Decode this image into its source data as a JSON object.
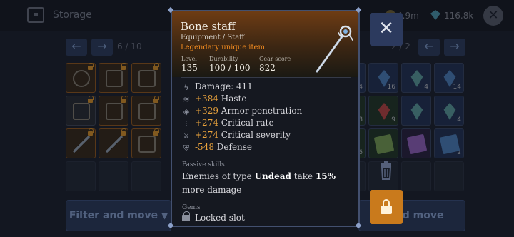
{
  "storage": {
    "title": "Storage",
    "gold": "4.9m",
    "gems": "116.8k",
    "close_label": "✕"
  },
  "left_pager": {
    "page": "6 / 10",
    "prev": "←",
    "next": "→"
  },
  "right_pager": {
    "page": "2 / 2",
    "prev": "←",
    "next": "→"
  },
  "left_grid": {
    "rows": [
      [
        {
          "icon": "ring-icon",
          "rarity": "orange"
        },
        {
          "icon": "gloves-icon",
          "rarity": "orange"
        },
        {
          "icon": "chest-armor-icon",
          "rarity": "orange"
        }
      ],
      [
        {
          "icon": "pauldron-icon",
          "rarity": "grey"
        },
        {
          "icon": "gloves-icon",
          "rarity": "orange"
        },
        {
          "icon": "chest-armor-icon",
          "rarity": "orange"
        }
      ],
      [
        {
          "icon": "staff-icon",
          "rarity": "orange"
        },
        {
          "icon": "staff-icon",
          "rarity": "orange"
        },
        {
          "icon": "crown-icon",
          "rarity": "orange"
        }
      ]
    ]
  },
  "right_grid": {
    "rows": [
      [
        {
          "icon": "crystal-icon",
          "color": "blue",
          "count": "4"
        },
        {
          "icon": "crystal-icon",
          "color": "blue",
          "count": "16"
        },
        {
          "icon": "crystal-icon",
          "color": "teal",
          "count": "4"
        },
        {
          "icon": "crystal-icon",
          "color": "blue",
          "count": "14"
        }
      ],
      [
        {
          "icon": "crystal-icon",
          "color": "green",
          "count": "8"
        },
        {
          "icon": "crystal-icon",
          "color": "red",
          "count": "9"
        },
        {
          "icon": "crystal-icon",
          "color": "teal",
          "count": ""
        },
        {
          "icon": "crystal-icon",
          "color": "teal",
          "count": "4"
        }
      ],
      [
        {
          "icon": "crystal-icon",
          "color": "green",
          "count": "16"
        },
        {
          "icon": "book-icon",
          "color": "green",
          "count": ""
        },
        {
          "icon": "book-icon",
          "color": "purple",
          "count": ""
        },
        {
          "icon": "book-icon",
          "color": "blue",
          "count": "2"
        }
      ]
    ]
  },
  "bottom": {
    "left_label": "Filter and move",
    "right_label": "r and move"
  },
  "item": {
    "name": "Bone staff",
    "type": "Equipment / Staff",
    "rarity": "Legendary unique item",
    "level_label": "Level",
    "level": "135",
    "durability_label": "Durability",
    "durability": "100 / 100",
    "gearscore_label": "Gear score",
    "gearscore": "822",
    "stats": [
      {
        "icon": "lightning-icon",
        "prefix": "",
        "label": "Damage: 411"
      },
      {
        "icon": "wing-icon",
        "prefix": "+384",
        "label": " Haste"
      },
      {
        "icon": "shield-break-icon",
        "prefix": "+329",
        "label": " Armor penetration"
      },
      {
        "icon": "claws-icon",
        "prefix": "+274",
        "label": " Critical rate"
      },
      {
        "icon": "slash-icon",
        "prefix": "+274",
        "label": " Critical severity"
      },
      {
        "icon": "defense-icon",
        "prefix": "-548",
        "label": " Defense"
      }
    ],
    "passive_title": "Passive skills",
    "passive_pre": "Enemies of type ",
    "passive_type": "Undead",
    "passive_mid": " take ",
    "passive_pct": "15%",
    "passive_post": " more damage",
    "gems_title": "Gems",
    "gem_slot": "Locked slot"
  },
  "colors": {
    "rarity_orange": "#f0891f",
    "stat_bonus": "#e9a23c",
    "accent_blue": "#2c3c61",
    "lock_orange": "#c97a1c"
  }
}
